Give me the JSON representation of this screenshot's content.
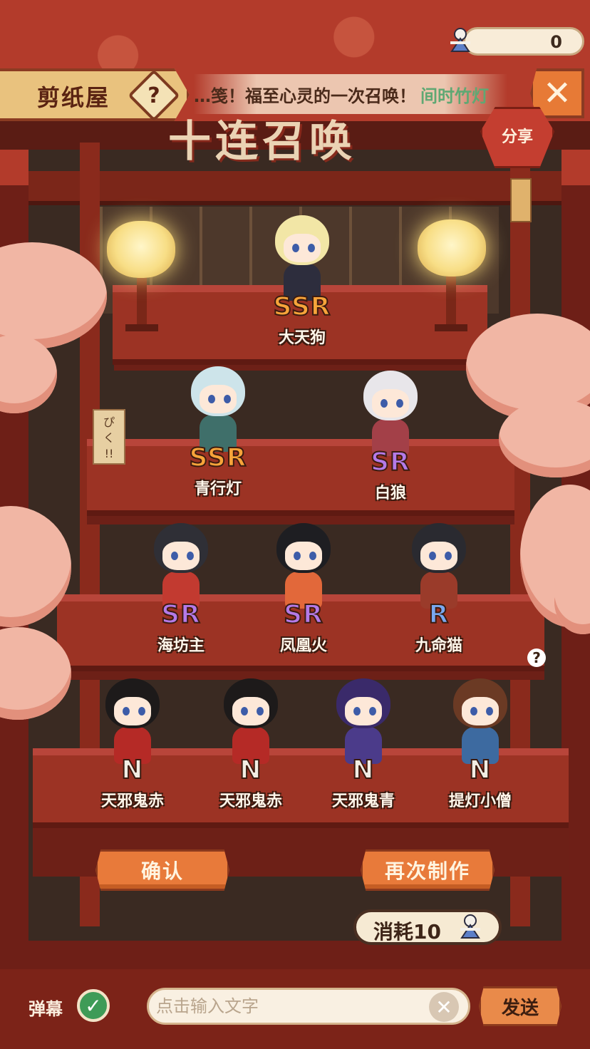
{
  "header": {
    "title": "剪纸屋",
    "help_glyph": "?",
    "close_glyph": "✕",
    "big_title": "十连召唤"
  },
  "banner": {
    "message": "…笺！福至心灵的一次召唤！",
    "player": "间时竹灯"
  },
  "currency": {
    "value": "0",
    "icon": "paper-doll-icon"
  },
  "share": {
    "label": "分享"
  },
  "sign": {
    "text": "ぴ\nく\n!!"
  },
  "results": [
    {
      "rarity": "SSR",
      "name": "大天狗",
      "hair": "#f2e6a6",
      "outfit": "#2d2d3d"
    },
    {
      "rarity": "SSR",
      "name": "青行灯",
      "hair": "#cde4ea",
      "outfit": "#3f6f6a"
    },
    {
      "rarity": "SR",
      "name": "白狼",
      "hair": "#e8e6ea",
      "outfit": "#a34048"
    },
    {
      "rarity": "SR",
      "name": "海坊主",
      "hair": "#2f2f36",
      "outfit": "#c23a30"
    },
    {
      "rarity": "SR",
      "name": "凤凰火",
      "hair": "#1e1e22",
      "outfit": "#e2683a"
    },
    {
      "rarity": "R",
      "name": "九命猫",
      "hair": "#2a2a30",
      "outfit": "#9a3b2a"
    },
    {
      "rarity": "N",
      "name": "天邪鬼赤",
      "hair": "#1d1a1a",
      "outfit": "#b52a26"
    },
    {
      "rarity": "N",
      "name": "天邪鬼赤",
      "hair": "#1d1a1a",
      "outfit": "#b52a26"
    },
    {
      "rarity": "N",
      "name": "天邪鬼青",
      "hair": "#3a2a6a",
      "outfit": "#4b3b8a"
    },
    {
      "rarity": "N",
      "name": "提灯小僧",
      "hair": "#6b3a24",
      "outfit": "#3d6aa0"
    }
  ],
  "buttons": {
    "confirm": "确认",
    "again": "再次制作"
  },
  "cost": {
    "label": "消耗10",
    "icon": "paper-doll-icon"
  },
  "bottom": {
    "danmu_label": "弹幕",
    "check_glyph": "✓",
    "input_placeholder": "点击输入文字",
    "input_value": "",
    "clear_glyph": "✕",
    "send": "发送"
  },
  "hint": "?",
  "colors": {
    "ssr": "#f7a43a",
    "sr": "#b47ae8",
    "r": "#79a8f0",
    "n": "#f1ede3",
    "accent": "#e87a3a"
  }
}
